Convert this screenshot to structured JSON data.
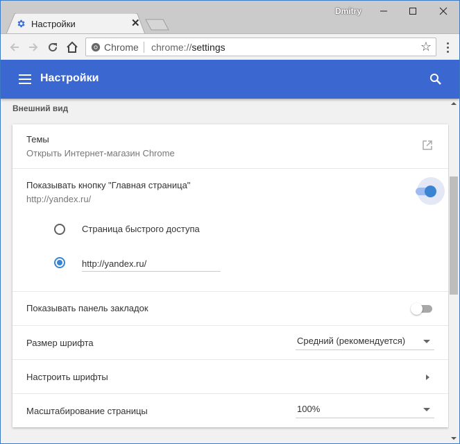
{
  "window": {
    "user_name": "Dmitry",
    "minimize_label": "—",
    "maximize_label": "☐",
    "close_label": "✕"
  },
  "tab": {
    "title": "Настройки",
    "icon": "gear-icon",
    "close_label": "✕"
  },
  "toolbar": {
    "omnibox": {
      "chip": "Chrome",
      "url_scheme": "chrome://",
      "url_host": "settings"
    },
    "star_label": "☆"
  },
  "header": {
    "title": "Настройки"
  },
  "section": {
    "title": "Внешний вид"
  },
  "settings": {
    "themes": {
      "label": "Темы",
      "sub": "Открыть Интернет-магазин Chrome"
    },
    "home_button": {
      "label": "Показывать кнопку \"Главная страница\"",
      "sub": "http://yandex.ru/",
      "enabled": true,
      "options": [
        {
          "label": "Страница быстрого доступа",
          "checked": false
        },
        {
          "value": "http://yandex.ru/",
          "checked": true
        }
      ]
    },
    "bookmarks_bar": {
      "label": "Показывать панель закладок",
      "enabled": false
    },
    "font_size": {
      "label": "Размер шрифта",
      "value": "Средний (рекомендуется)"
    },
    "customize_fonts": {
      "label": "Настроить шрифты"
    },
    "page_zoom": {
      "label": "Масштабирование страницы",
      "value": "100%"
    }
  },
  "colors": {
    "header": "#3b67d0",
    "accent": "#3a84d2"
  }
}
